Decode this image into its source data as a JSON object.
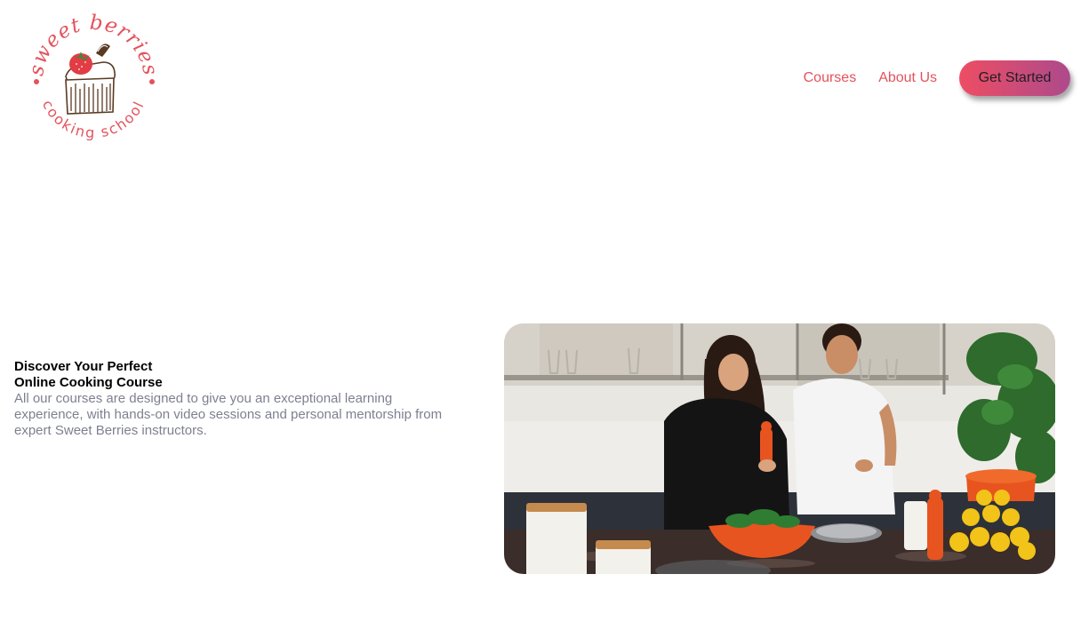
{
  "brand": {
    "name_top": "sweet berries",
    "name_bottom": "cooking school",
    "accent_color": "#e4525c",
    "logo_icon": "cupcake-strawberry-icon"
  },
  "nav": {
    "items": [
      {
        "label": "Courses"
      },
      {
        "label": "About Us"
      }
    ],
    "cta_label": "Get Started"
  },
  "hero": {
    "title_line1": "Discover Your Perfect",
    "title_line2": "Online Cooking Course",
    "body": "All our courses are designed to give you an exceptional learning experience, with hands-on video sessions and personal mentorship from expert Sweet Berries instructors.",
    "photo_icon": "kitchen-couple-cooking-photo"
  }
}
